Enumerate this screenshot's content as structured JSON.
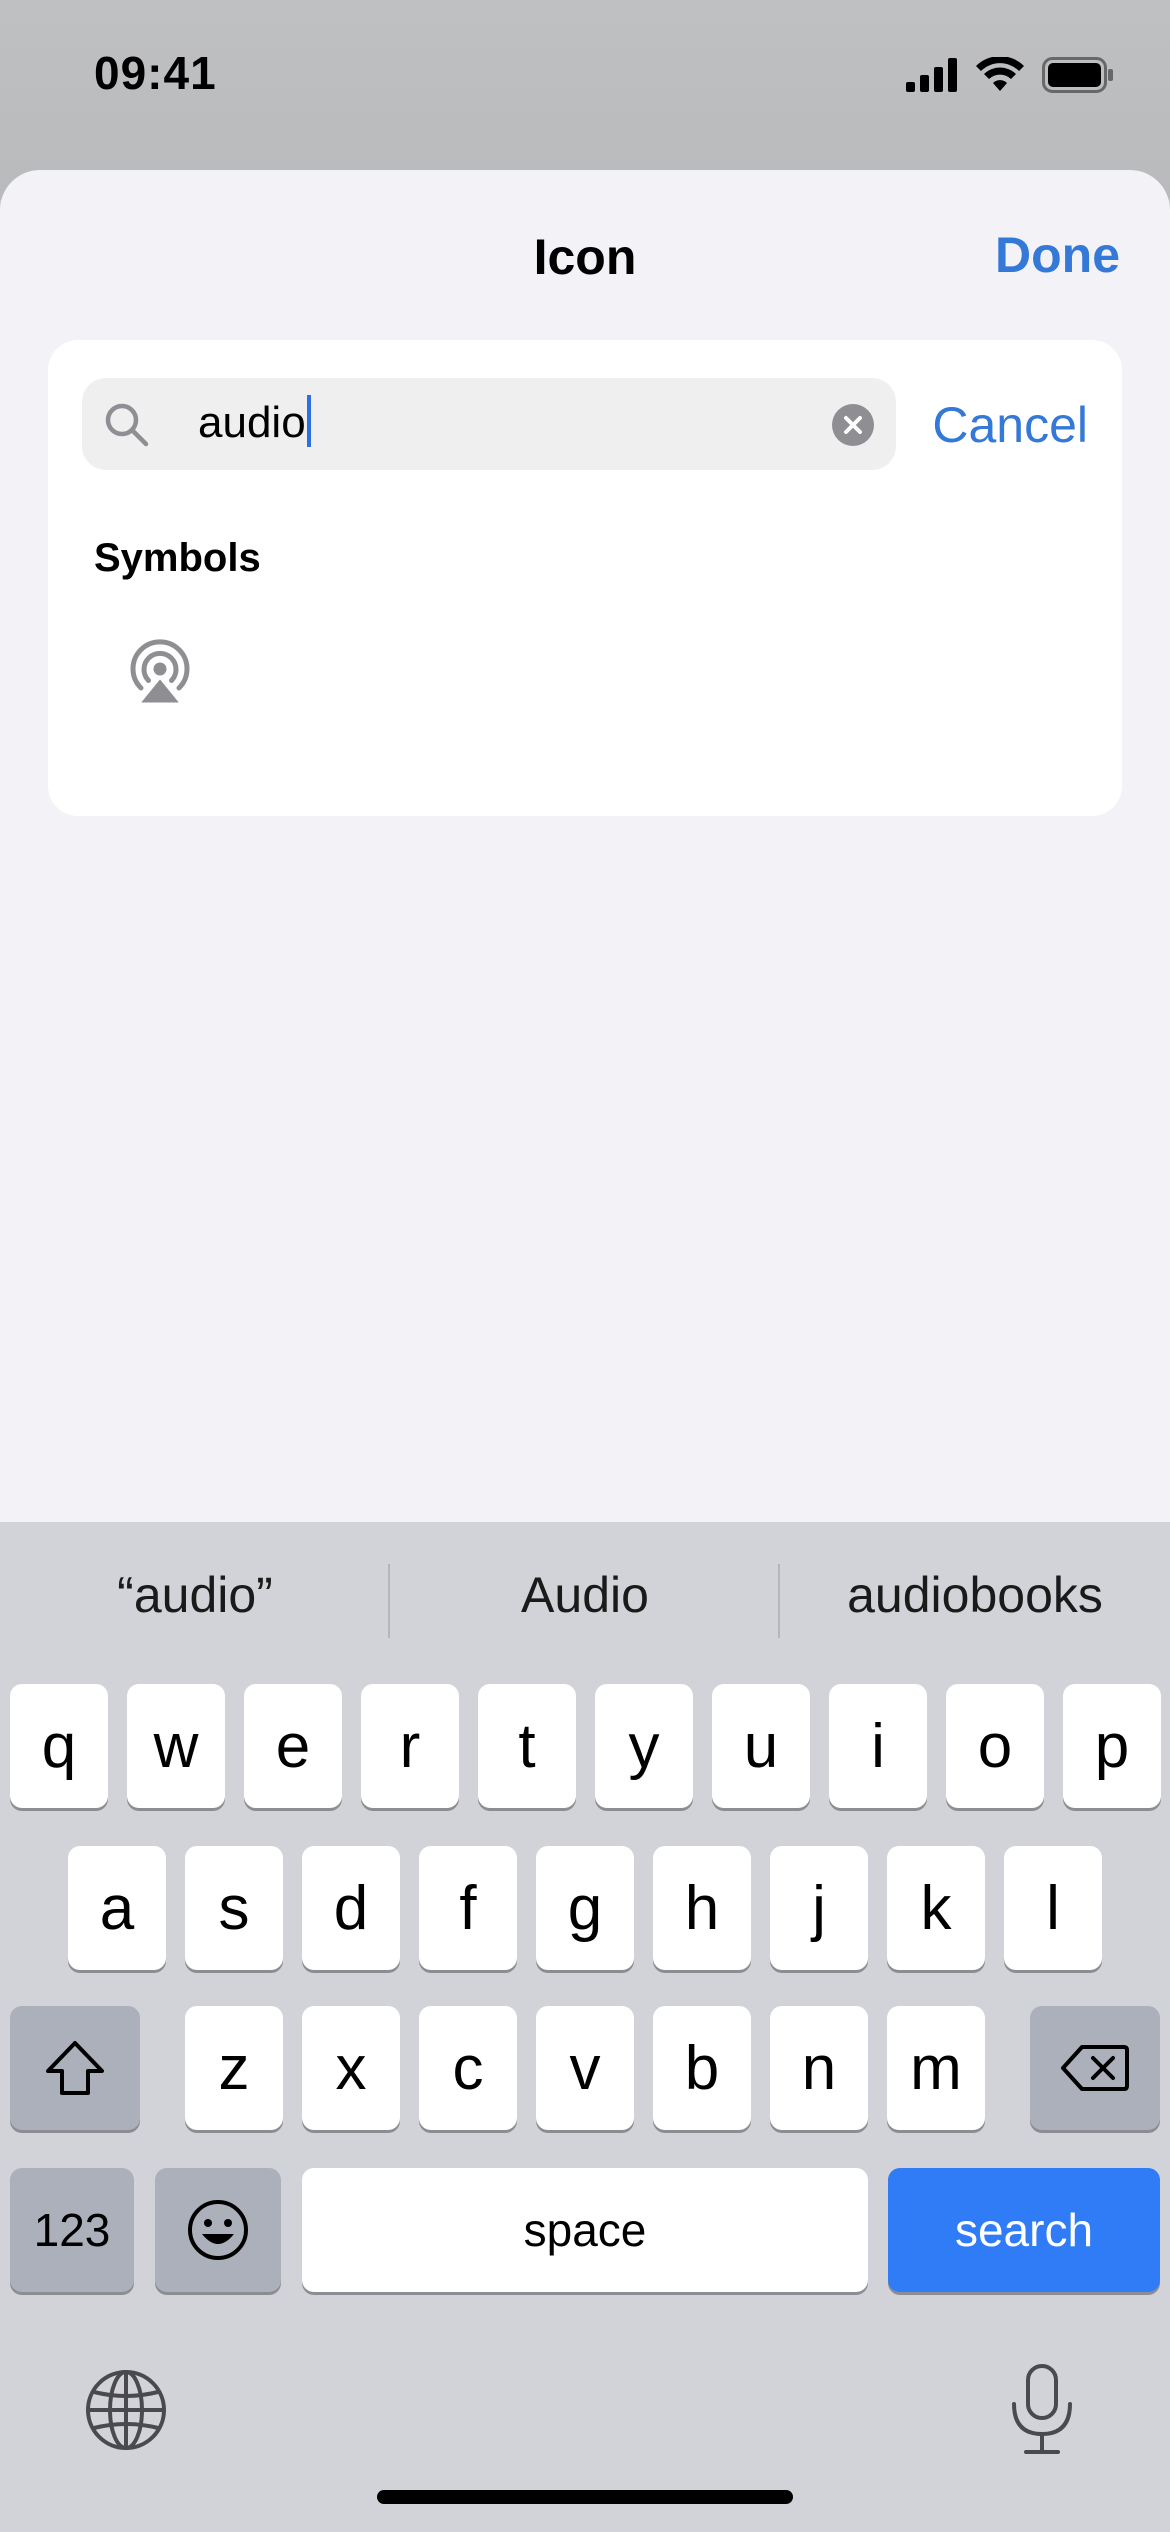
{
  "status_bar": {
    "time": "09:41",
    "icons": [
      "cellular-signal-icon",
      "wifi-icon",
      "battery-icon"
    ]
  },
  "sheet": {
    "title": "Icon",
    "done_label": "Done"
  },
  "search": {
    "value": "audio",
    "cancel_label": "Cancel"
  },
  "results": {
    "section_title": "Symbols",
    "symbols": [
      "airplay-audio-icon"
    ]
  },
  "keyboard": {
    "suggestions": [
      "“audio”",
      "Audio",
      "audiobooks"
    ],
    "row1": [
      "q",
      "w",
      "e",
      "r",
      "t",
      "y",
      "u",
      "i",
      "o",
      "p"
    ],
    "row2": [
      "a",
      "s",
      "d",
      "f",
      "g",
      "h",
      "j",
      "k",
      "l"
    ],
    "row3": [
      "z",
      "x",
      "c",
      "v",
      "b",
      "n",
      "m"
    ],
    "numbers_label": "123",
    "space_label": "space",
    "search_label": "search"
  },
  "colors": {
    "accent": "#3478d8",
    "search_key": "#2f7cf6",
    "sheet_bg": "#f2f2f7",
    "keyboard_bg": "#d1d3d8"
  }
}
